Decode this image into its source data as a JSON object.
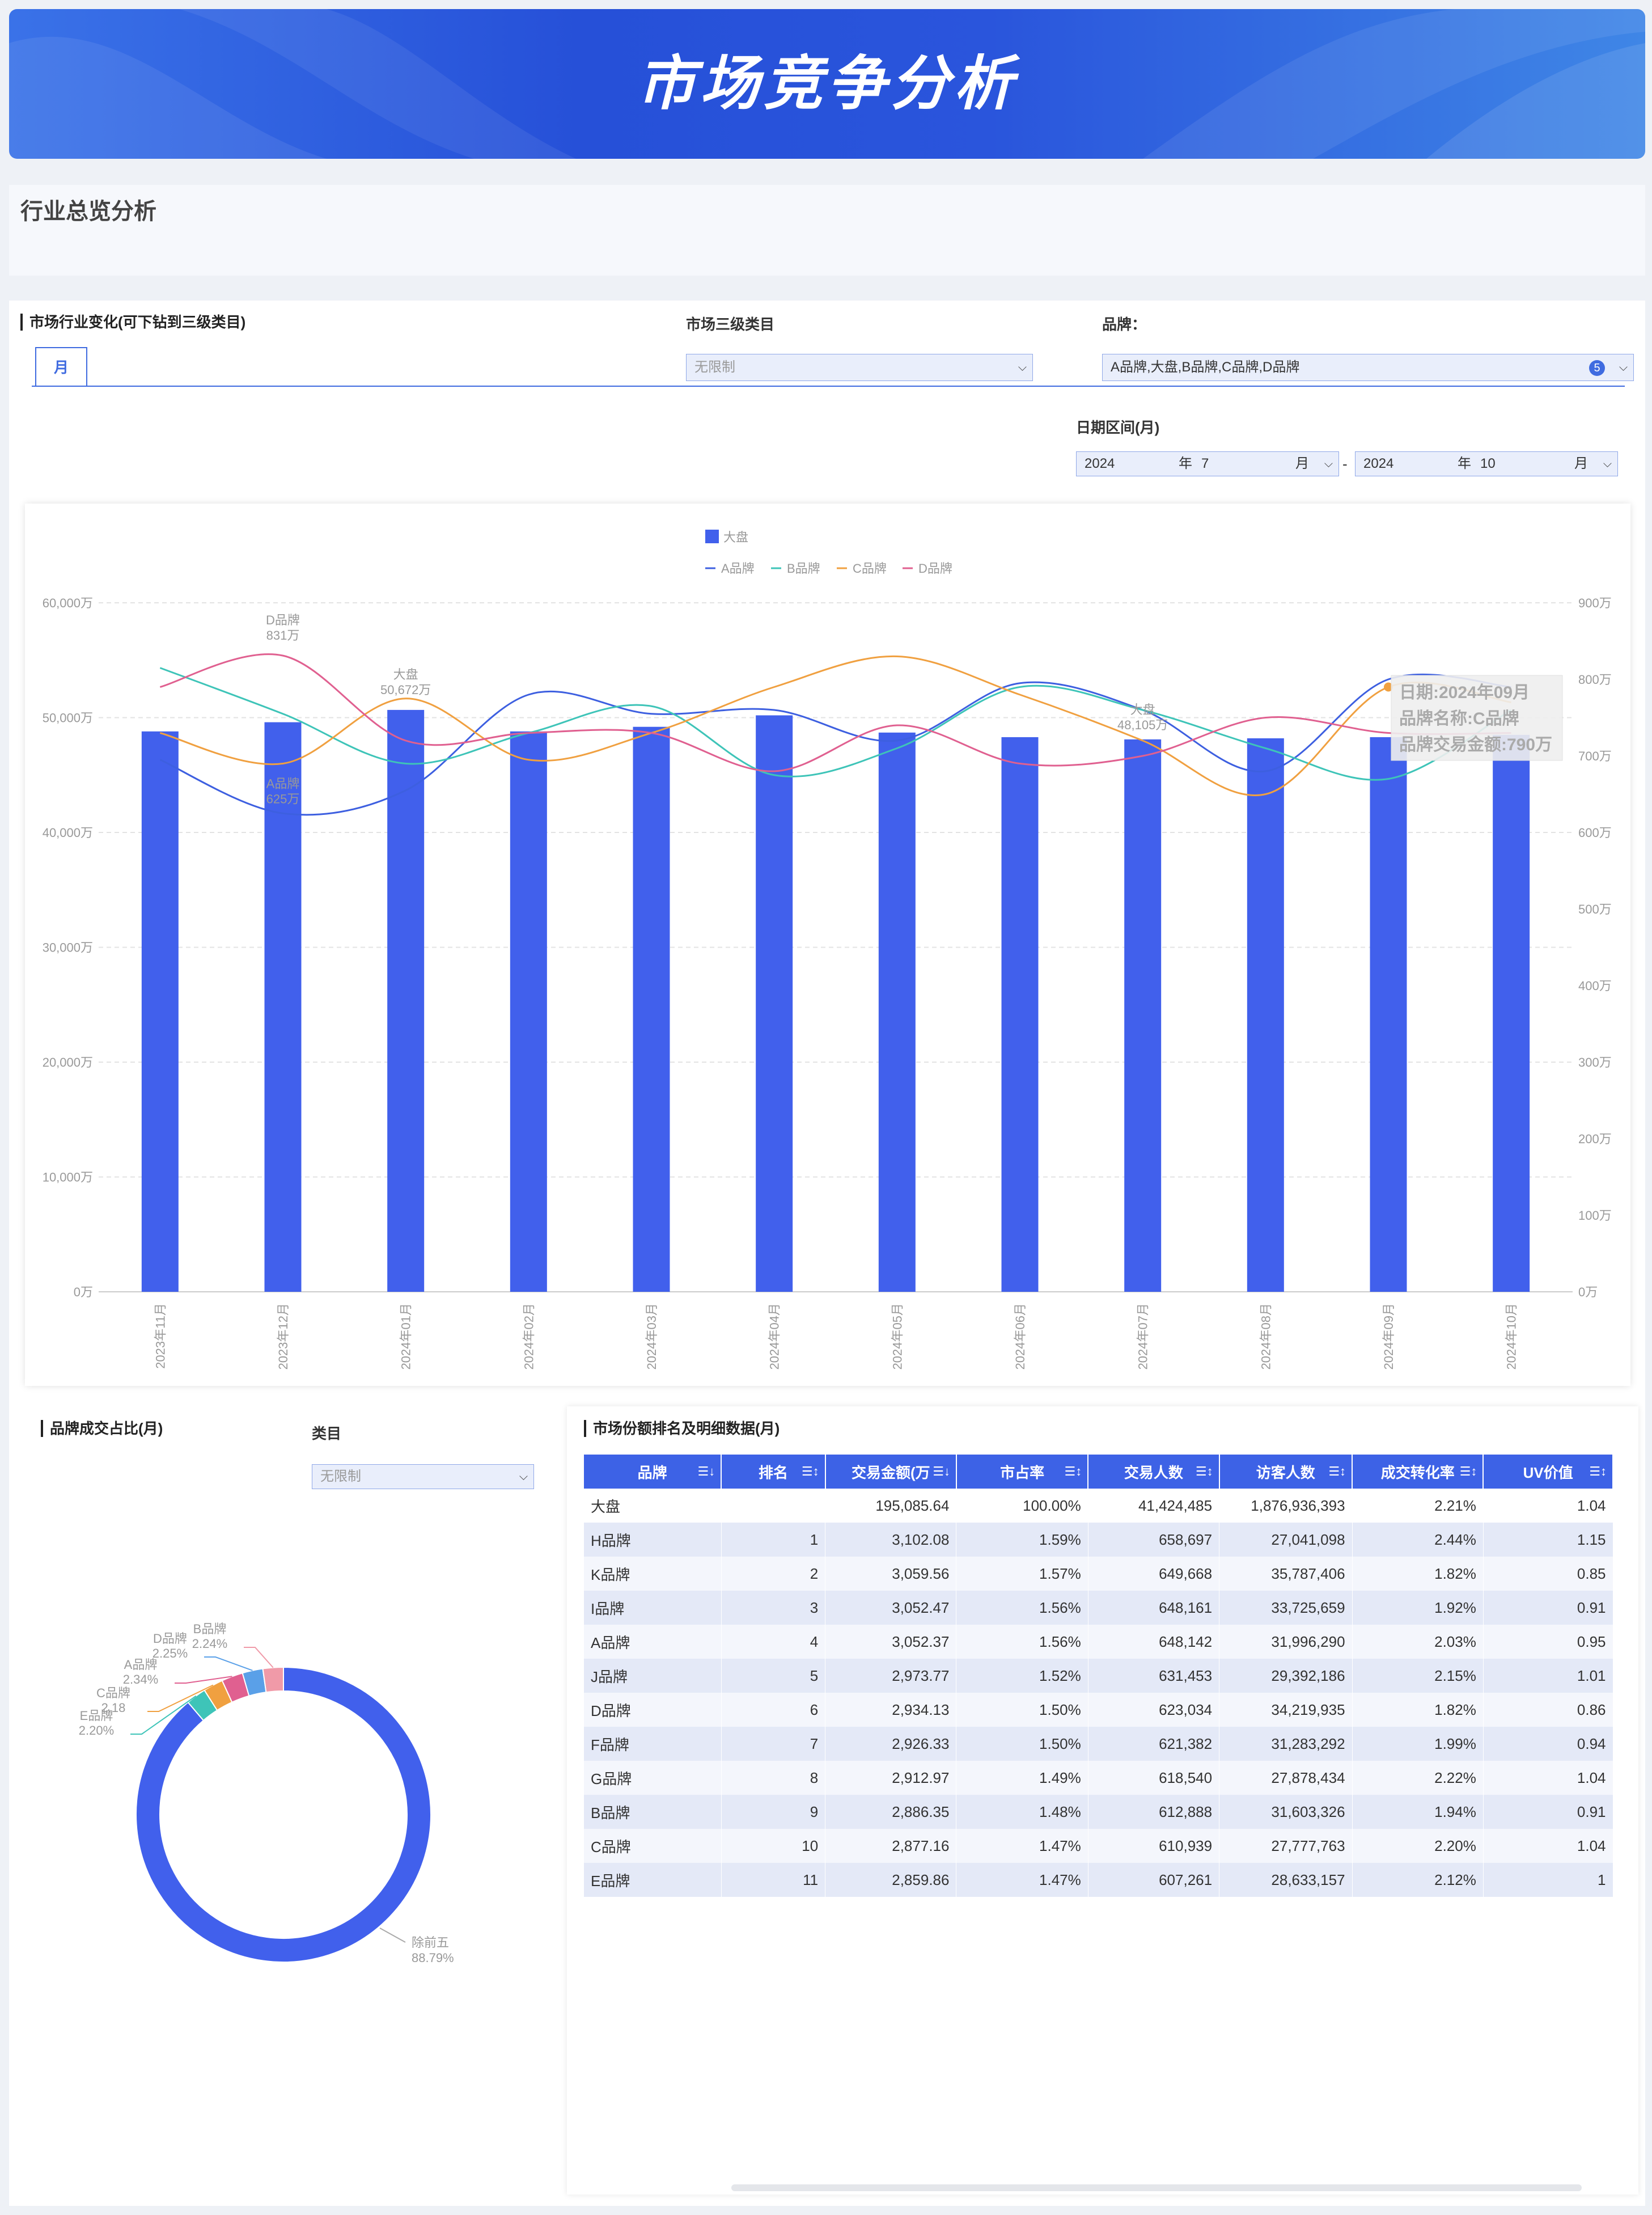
{
  "header": {
    "title": "市场竞争分析"
  },
  "overview": {
    "title": "行业总览分析"
  },
  "filters": {
    "industry_title": "市场行业变化(可下钻到三级类目)",
    "tab_month": "月",
    "category_label": "市场三级类目",
    "category_value": "无限制",
    "brand_label": "品牌：",
    "brand_value": "A品牌,大盘,B品牌,C品牌,D品牌",
    "brand_count": "5",
    "date_label": "日期区间(月)",
    "start_year": "2024",
    "start_year_unit": "年",
    "start_month": "7",
    "start_month_unit": "月",
    "sep": "-",
    "end_year": "2024",
    "end_year_unit": "年",
    "end_month": "10",
    "end_month_unit": "月"
  },
  "chart_data": {
    "type": "bar",
    "x": [
      "2023年11月",
      "2023年12月",
      "2024年01月",
      "2024年02月",
      "2024年03月",
      "2024年04月",
      "2024年05月",
      "2024年06月",
      "2024年07月",
      "2024年08月",
      "2024年09月",
      "2024年10月"
    ],
    "y_left": {
      "ylim": [
        0,
        60000
      ],
      "ticks": [
        "0万",
        "10,000万",
        "20,000万",
        "30,000万",
        "40,000万",
        "50,000万",
        "60,000万"
      ]
    },
    "y_right": {
      "ylim": [
        0,
        900
      ],
      "ticks": [
        "0万",
        "100万",
        "200万",
        "300万",
        "400万",
        "500万",
        "600万",
        "700万",
        "800万",
        "900万"
      ]
    },
    "bar_series": {
      "name": "大盘",
      "color": "#4160ec",
      "values": [
        48800,
        49600,
        50672,
        48800,
        49200,
        50200,
        48700,
        48300,
        48105,
        48200,
        48300,
        48500
      ]
    },
    "line_series": [
      {
        "name": "A品牌",
        "color": "#3d5fe0",
        "values": [
          695,
          625,
          655,
          780,
          755,
          760,
          720,
          795,
          760,
          680,
          800,
          790
        ]
      },
      {
        "name": "B品牌",
        "color": "#3ec4b8",
        "values": [
          815,
          755,
          690,
          730,
          765,
          675,
          710,
          790,
          760,
          710,
          670,
          760
        ]
      },
      {
        "name": "C品牌",
        "color": "#f0a040",
        "values": [
          730,
          690,
          775,
          695,
          730,
          790,
          830,
          780,
          720,
          650,
          790,
          770
        ]
      },
      {
        "name": "D品牌",
        "color": "#e06090",
        "values": [
          790,
          831,
          720,
          730,
          730,
          680,
          740,
          690,
          700,
          750,
          730,
          730
        ]
      }
    ],
    "annotations": [
      {
        "series": "D品牌",
        "label": "D品牌",
        "value": "831万"
      },
      {
        "series": "A品牌",
        "label": "A品牌",
        "value": "625万"
      },
      {
        "series": "大盘",
        "label": "大盘",
        "value": "50,672万"
      },
      {
        "series": "大盘",
        "label": "大盘",
        "value": "48,105万"
      }
    ],
    "tooltip": {
      "lines": [
        "日期:2024年09月",
        "品牌名称:C品牌",
        "品牌交易金额:790万"
      ]
    },
    "legend": "top-center"
  },
  "pie": {
    "title": "品牌成交占比(月)",
    "category_label": "类目",
    "category_value": "无限制",
    "slices": [
      {
        "name": "除前五",
        "value": 88.79,
        "color": "#4160ec"
      },
      {
        "name": "E品牌",
        "value": 2.2,
        "color": "#3ec4b8"
      },
      {
        "name": "C品牌",
        "value": 2.18,
        "color": "#f0a040"
      },
      {
        "name": "A品牌",
        "value": 2.34,
        "color": "#e06090"
      },
      {
        "name": "D品牌",
        "value": 2.25,
        "color": "#5aa0e8"
      },
      {
        "name": "B品牌",
        "value": 2.24,
        "color": "#f09aa8"
      }
    ],
    "labels": [
      {
        "name": "E品牌",
        "pct": "2.20%"
      },
      {
        "name": "C品牌",
        "pct": "2.18"
      },
      {
        "name": "A品牌",
        "pct": "2.34%"
      },
      {
        "name": "D品牌",
        "pct": "2.25%"
      },
      {
        "name": "B品牌",
        "pct": "2.24%"
      },
      {
        "name": "除前五",
        "pct": "88.79%"
      }
    ]
  },
  "table": {
    "title": "市场份额排名及明细数据(月)",
    "columns": [
      "品牌",
      "排名",
      "交易金额(万",
      "市占率",
      "交易人数",
      "访客人数",
      "成交转化率",
      "UV价值"
    ],
    "rows": [
      [
        "大盘",
        "",
        "195,085.64",
        "100.00%",
        "41,424,485",
        "1,876,936,393",
        "2.21%",
        "1.04"
      ],
      [
        "H品牌",
        "1",
        "3,102.08",
        "1.59%",
        "658,697",
        "27,041,098",
        "2.44%",
        "1.15"
      ],
      [
        "K品牌",
        "2",
        "3,059.56",
        "1.57%",
        "649,668",
        "35,787,406",
        "1.82%",
        "0.85"
      ],
      [
        "I品牌",
        "3",
        "3,052.47",
        "1.56%",
        "648,161",
        "33,725,659",
        "1.92%",
        "0.91"
      ],
      [
        "A品牌",
        "4",
        "3,052.37",
        "1.56%",
        "648,142",
        "31,996,290",
        "2.03%",
        "0.95"
      ],
      [
        "J品牌",
        "5",
        "2,973.77",
        "1.52%",
        "631,453",
        "29,392,186",
        "2.15%",
        "1.01"
      ],
      [
        "D品牌",
        "6",
        "2,934.13",
        "1.50%",
        "623,034",
        "34,219,935",
        "1.82%",
        "0.86"
      ],
      [
        "F品牌",
        "7",
        "2,926.33",
        "1.50%",
        "621,382",
        "31,283,292",
        "1.99%",
        "0.94"
      ],
      [
        "G品牌",
        "8",
        "2,912.97",
        "1.49%",
        "618,540",
        "27,878,434",
        "2.22%",
        "1.04"
      ],
      [
        "B品牌",
        "9",
        "2,886.35",
        "1.48%",
        "612,888",
        "31,603,326",
        "1.94%",
        "0.91"
      ],
      [
        "C品牌",
        "10",
        "2,877.16",
        "1.47%",
        "610,939",
        "27,777,763",
        "2.20%",
        "1.04"
      ],
      [
        "E品牌",
        "11",
        "2,859.86",
        "1.47%",
        "607,261",
        "28,633,157",
        "2.12%",
        "1"
      ]
    ]
  }
}
